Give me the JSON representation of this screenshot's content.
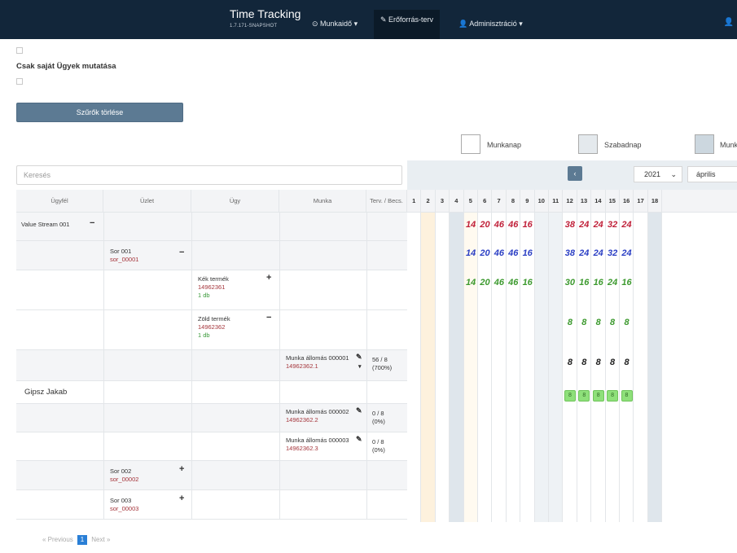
{
  "navbar": {
    "brand": "Time Tracking",
    "version": "1.7.171-SNAPSHOT",
    "items": [
      {
        "label": "⊙ Munkaidő ▾"
      },
      {
        "label": "✎ Erőforrás-terv"
      },
      {
        "label": "👤 Adminisztráció ▾"
      }
    ],
    "user_icon": "user-icon"
  },
  "filters": {
    "own_cases_label": "Csak saját Ügyek mutatása",
    "clear_button": "Szűrők törlése"
  },
  "legend": [
    {
      "label": "Munkanap",
      "color": "#ffffff"
    },
    {
      "label": "Szabadnap",
      "color": "#e4e9ed"
    },
    {
      "label": "Munk",
      "color": "#ccd7df"
    }
  ],
  "search": {
    "placeholder": "Keresés"
  },
  "calendar": {
    "prev_label": "‹",
    "year": "2021",
    "month": "április",
    "chevron": "⌄"
  },
  "table": {
    "headers": [
      "Ügyfél",
      "Üzlet",
      "Ügy",
      "Munka",
      "Terv. / Becs."
    ],
    "days": [
      "1",
      "2",
      "3",
      "4",
      "5",
      "6",
      "7",
      "8",
      "9",
      "10",
      "11",
      "12",
      "13",
      "14",
      "15",
      "16",
      "17",
      "18"
    ],
    "rows": [
      {
        "client": "Value Stream 001",
        "client_sign": "−"
      },
      {
        "deal": "Sor 001",
        "deal_code": "sor_00001",
        "deal_sign": "−"
      },
      {
        "case": "Kék termék",
        "case_code": "14962361",
        "case_qty": "1 db",
        "case_sign": "+"
      },
      {
        "case": "Zöld termék",
        "case_code": "14962362",
        "case_qty": "1 db",
        "case_sign": "−"
      },
      {
        "work": "Munka állomás 000001",
        "work_code": "14962362.1",
        "plan": "56 / 8",
        "pct": "(700%)"
      },
      {
        "person": "Gipsz Jakab"
      },
      {
        "work": "Munka állomás 000002",
        "work_code": "14962362.2",
        "plan": "0 / 8",
        "pct": "(0%)"
      },
      {
        "work": "Munka állomás 000003",
        "work_code": "14962362.3",
        "plan": "0 / 8",
        "pct": "(0%)"
      },
      {
        "deal": "Sor 002",
        "deal_code": "sor_00002",
        "deal_sign": "+"
      },
      {
        "deal": "Sor 003",
        "deal_code": "sor_00003",
        "deal_sign": "+"
      }
    ],
    "hours": {
      "row0": {
        "color": "#c0213a",
        "d5": "14",
        "d6": "20",
        "d7": "46",
        "d8": "46",
        "d9": "16",
        "d12": "38",
        "d13": "24",
        "d14": "24",
        "d15": "32",
        "d16": "24"
      },
      "row1": {
        "color": "#2b3fc4",
        "d5": "14",
        "d6": "20",
        "d7": "46",
        "d8": "46",
        "d9": "16",
        "d12": "38",
        "d13": "24",
        "d14": "24",
        "d15": "32",
        "d16": "24"
      },
      "row2": {
        "color": "#3d9a2f",
        "d5": "14",
        "d6": "20",
        "d7": "46",
        "d8": "46",
        "d9": "16",
        "d12": "30",
        "d13": "16",
        "d14": "16",
        "d15": "24",
        "d16": "16"
      },
      "row3": {
        "color": "#3d9a2f",
        "d12": "8",
        "d13": "8",
        "d14": "8",
        "d15": "8",
        "d16": "8"
      },
      "row4": {
        "color": "#222222",
        "d12": "8",
        "d13": "8",
        "d14": "8",
        "d15": "8",
        "d16": "8"
      },
      "row5": {
        "d12": "8",
        "d13": "8",
        "d14": "8",
        "d15": "8",
        "d16": "8"
      }
    }
  },
  "pager": {
    "previous": "« Previous",
    "current": "1",
    "next": "Next »"
  }
}
